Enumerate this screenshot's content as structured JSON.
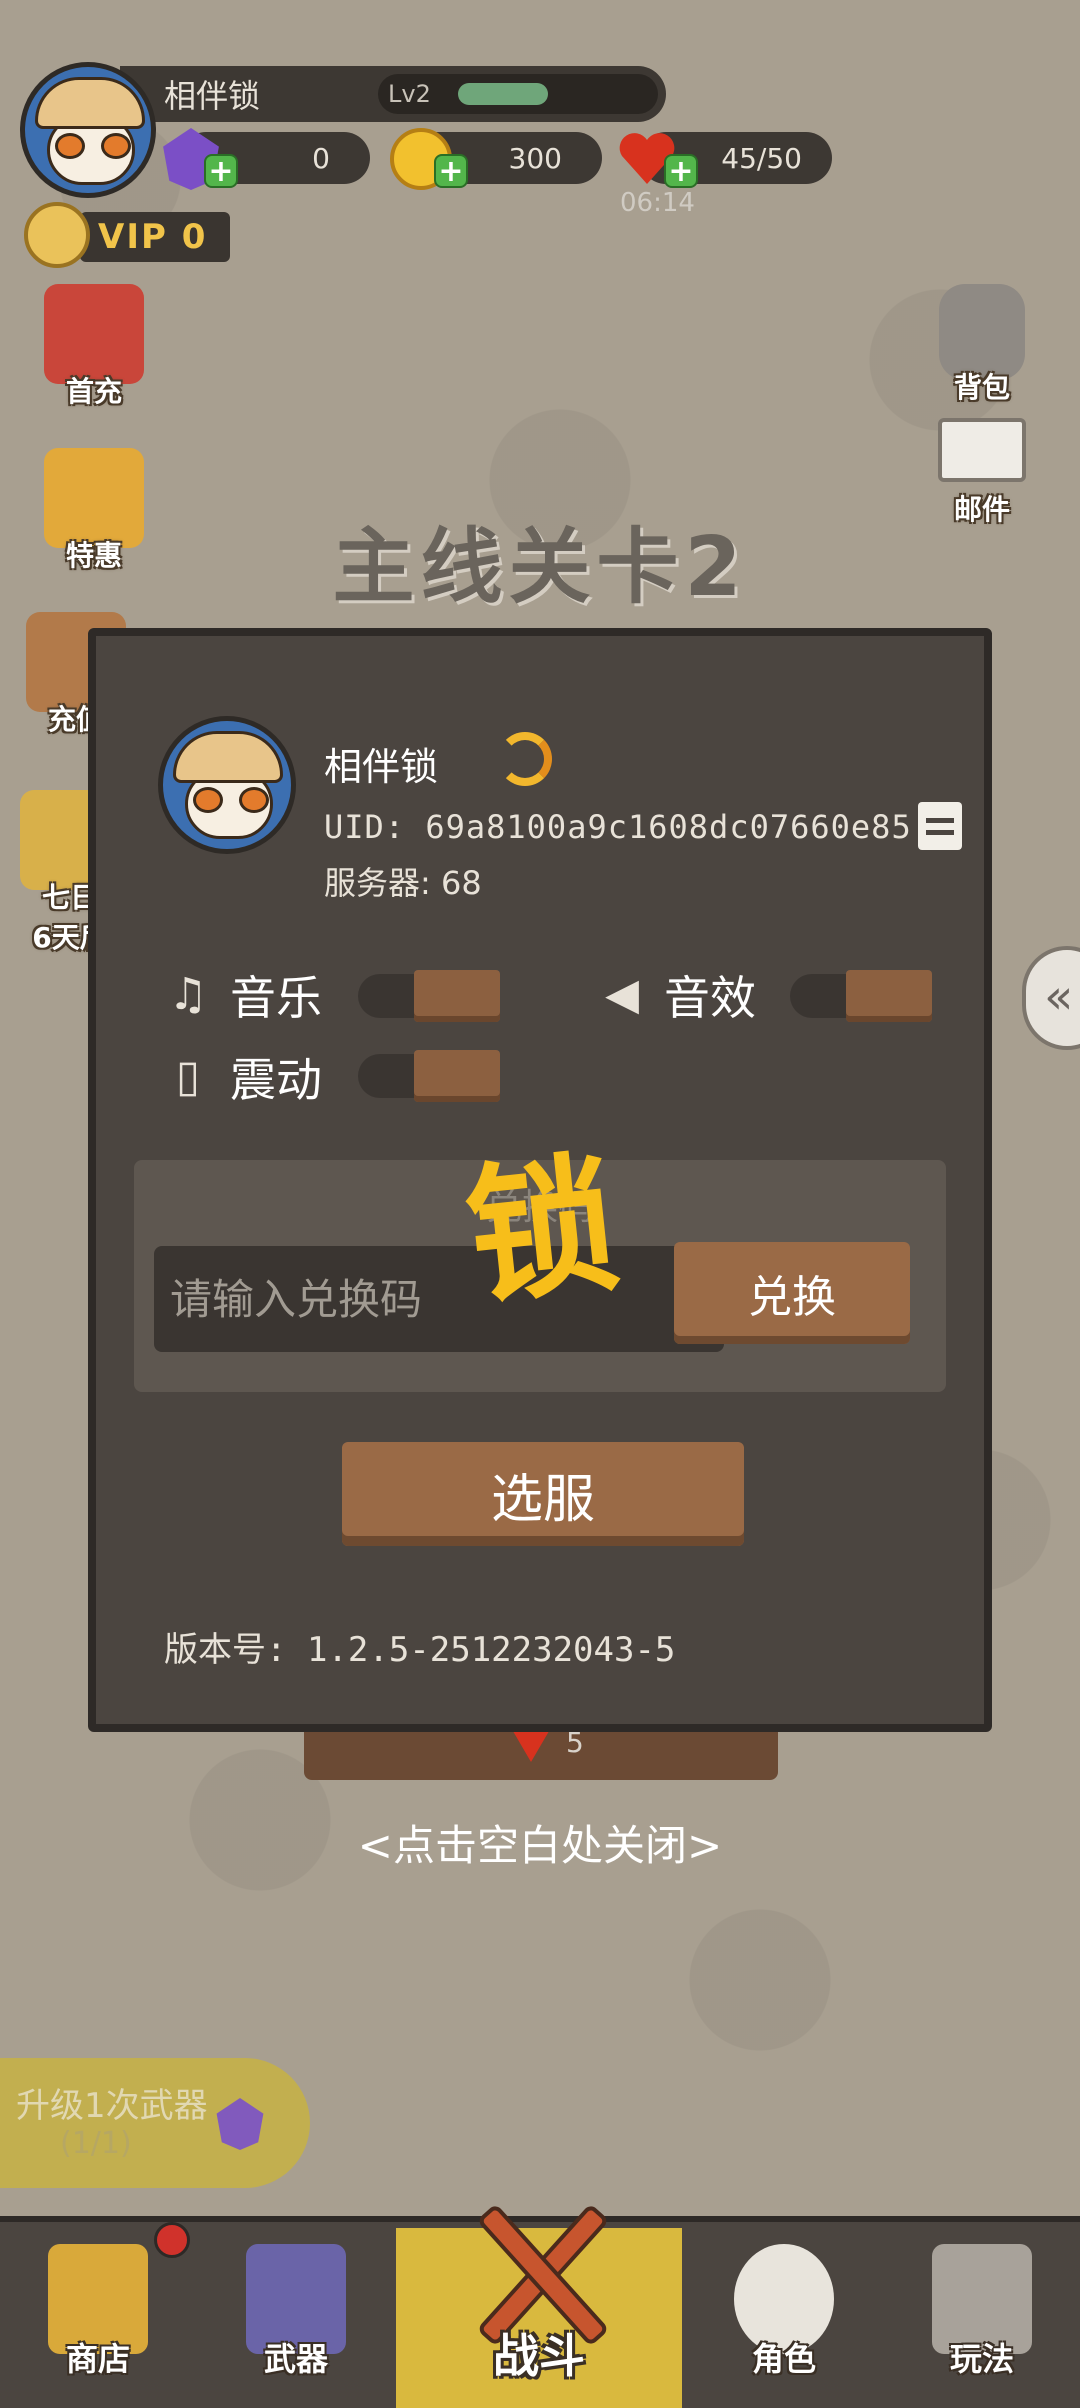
{
  "player": {
    "name": "相伴锁",
    "level": "Lv2",
    "level_progress": 0.3
  },
  "resources": {
    "gems": "0",
    "coins": "300",
    "stamina": "45/50",
    "stamina_timer": "06:14"
  },
  "vip": {
    "label": "VIP 0"
  },
  "side_buttons": {
    "first_recharge": "首充",
    "special_offer": "特惠",
    "recharge": "充值",
    "seven_day": "七日",
    "seven_day_sub": "6天后"
  },
  "right_buttons": {
    "backpack": "背包",
    "mail": "邮件"
  },
  "stage_title": "主线关卡2",
  "panel": {
    "name": "相伴锁",
    "uid": "UID: 69a8100a9c1608dc07660e85",
    "server": "服务器: 68",
    "settings": {
      "music": "音乐",
      "sound": "音效",
      "vibration": "震动"
    },
    "redeem_title": "兑换码",
    "redeem_placeholder": "请输入兑换码",
    "redeem_button": "兑换",
    "lock_overlay": "锁",
    "select_server": "选服",
    "version": "版本号: 1.2.5-2512232043-5"
  },
  "behind_cost": "5",
  "close_hint": "<点击空白处关闭>",
  "upgrade": {
    "text": "升级1次武器",
    "count": "(1/1)"
  },
  "nav": {
    "shop": "商店",
    "weapon": "武器",
    "battle": "战斗",
    "character": "角色",
    "gameplay": "玩法"
  }
}
